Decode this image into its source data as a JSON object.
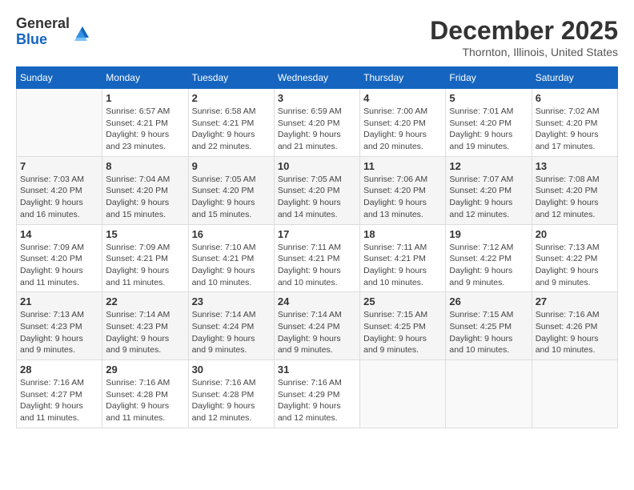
{
  "logo": {
    "general": "General",
    "blue": "Blue"
  },
  "header": {
    "month": "December 2025",
    "location": "Thornton, Illinois, United States"
  },
  "weekdays": [
    "Sunday",
    "Monday",
    "Tuesday",
    "Wednesday",
    "Thursday",
    "Friday",
    "Saturday"
  ],
  "weeks": [
    [
      {
        "day": "",
        "sunrise": "",
        "sunset": "",
        "daylight": ""
      },
      {
        "day": "1",
        "sunrise": "Sunrise: 6:57 AM",
        "sunset": "Sunset: 4:21 PM",
        "daylight": "Daylight: 9 hours and 23 minutes."
      },
      {
        "day": "2",
        "sunrise": "Sunrise: 6:58 AM",
        "sunset": "Sunset: 4:21 PM",
        "daylight": "Daylight: 9 hours and 22 minutes."
      },
      {
        "day": "3",
        "sunrise": "Sunrise: 6:59 AM",
        "sunset": "Sunset: 4:20 PM",
        "daylight": "Daylight: 9 hours and 21 minutes."
      },
      {
        "day": "4",
        "sunrise": "Sunrise: 7:00 AM",
        "sunset": "Sunset: 4:20 PM",
        "daylight": "Daylight: 9 hours and 20 minutes."
      },
      {
        "day": "5",
        "sunrise": "Sunrise: 7:01 AM",
        "sunset": "Sunset: 4:20 PM",
        "daylight": "Daylight: 9 hours and 19 minutes."
      },
      {
        "day": "6",
        "sunrise": "Sunrise: 7:02 AM",
        "sunset": "Sunset: 4:20 PM",
        "daylight": "Daylight: 9 hours and 17 minutes."
      }
    ],
    [
      {
        "day": "7",
        "sunrise": "Sunrise: 7:03 AM",
        "sunset": "Sunset: 4:20 PM",
        "daylight": "Daylight: 9 hours and 16 minutes."
      },
      {
        "day": "8",
        "sunrise": "Sunrise: 7:04 AM",
        "sunset": "Sunset: 4:20 PM",
        "daylight": "Daylight: 9 hours and 15 minutes."
      },
      {
        "day": "9",
        "sunrise": "Sunrise: 7:05 AM",
        "sunset": "Sunset: 4:20 PM",
        "daylight": "Daylight: 9 hours and 15 minutes."
      },
      {
        "day": "10",
        "sunrise": "Sunrise: 7:05 AM",
        "sunset": "Sunset: 4:20 PM",
        "daylight": "Daylight: 9 hours and 14 minutes."
      },
      {
        "day": "11",
        "sunrise": "Sunrise: 7:06 AM",
        "sunset": "Sunset: 4:20 PM",
        "daylight": "Daylight: 9 hours and 13 minutes."
      },
      {
        "day": "12",
        "sunrise": "Sunrise: 7:07 AM",
        "sunset": "Sunset: 4:20 PM",
        "daylight": "Daylight: 9 hours and 12 minutes."
      },
      {
        "day": "13",
        "sunrise": "Sunrise: 7:08 AM",
        "sunset": "Sunset: 4:20 PM",
        "daylight": "Daylight: 9 hours and 12 minutes."
      }
    ],
    [
      {
        "day": "14",
        "sunrise": "Sunrise: 7:09 AM",
        "sunset": "Sunset: 4:20 PM",
        "daylight": "Daylight: 9 hours and 11 minutes."
      },
      {
        "day": "15",
        "sunrise": "Sunrise: 7:09 AM",
        "sunset": "Sunset: 4:21 PM",
        "daylight": "Daylight: 9 hours and 11 minutes."
      },
      {
        "day": "16",
        "sunrise": "Sunrise: 7:10 AM",
        "sunset": "Sunset: 4:21 PM",
        "daylight": "Daylight: 9 hours and 10 minutes."
      },
      {
        "day": "17",
        "sunrise": "Sunrise: 7:11 AM",
        "sunset": "Sunset: 4:21 PM",
        "daylight": "Daylight: 9 hours and 10 minutes."
      },
      {
        "day": "18",
        "sunrise": "Sunrise: 7:11 AM",
        "sunset": "Sunset: 4:21 PM",
        "daylight": "Daylight: 9 hours and 10 minutes."
      },
      {
        "day": "19",
        "sunrise": "Sunrise: 7:12 AM",
        "sunset": "Sunset: 4:22 PM",
        "daylight": "Daylight: 9 hours and 9 minutes."
      },
      {
        "day": "20",
        "sunrise": "Sunrise: 7:13 AM",
        "sunset": "Sunset: 4:22 PM",
        "daylight": "Daylight: 9 hours and 9 minutes."
      }
    ],
    [
      {
        "day": "21",
        "sunrise": "Sunrise: 7:13 AM",
        "sunset": "Sunset: 4:23 PM",
        "daylight": "Daylight: 9 hours and 9 minutes."
      },
      {
        "day": "22",
        "sunrise": "Sunrise: 7:14 AM",
        "sunset": "Sunset: 4:23 PM",
        "daylight": "Daylight: 9 hours and 9 minutes."
      },
      {
        "day": "23",
        "sunrise": "Sunrise: 7:14 AM",
        "sunset": "Sunset: 4:24 PM",
        "daylight": "Daylight: 9 hours and 9 minutes."
      },
      {
        "day": "24",
        "sunrise": "Sunrise: 7:14 AM",
        "sunset": "Sunset: 4:24 PM",
        "daylight": "Daylight: 9 hours and 9 minutes."
      },
      {
        "day": "25",
        "sunrise": "Sunrise: 7:15 AM",
        "sunset": "Sunset: 4:25 PM",
        "daylight": "Daylight: 9 hours and 9 minutes."
      },
      {
        "day": "26",
        "sunrise": "Sunrise: 7:15 AM",
        "sunset": "Sunset: 4:25 PM",
        "daylight": "Daylight: 9 hours and 10 minutes."
      },
      {
        "day": "27",
        "sunrise": "Sunrise: 7:16 AM",
        "sunset": "Sunset: 4:26 PM",
        "daylight": "Daylight: 9 hours and 10 minutes."
      }
    ],
    [
      {
        "day": "28",
        "sunrise": "Sunrise: 7:16 AM",
        "sunset": "Sunset: 4:27 PM",
        "daylight": "Daylight: 9 hours and 11 minutes."
      },
      {
        "day": "29",
        "sunrise": "Sunrise: 7:16 AM",
        "sunset": "Sunset: 4:28 PM",
        "daylight": "Daylight: 9 hours and 11 minutes."
      },
      {
        "day": "30",
        "sunrise": "Sunrise: 7:16 AM",
        "sunset": "Sunset: 4:28 PM",
        "daylight": "Daylight: 9 hours and 12 minutes."
      },
      {
        "day": "31",
        "sunrise": "Sunrise: 7:16 AM",
        "sunset": "Sunset: 4:29 PM",
        "daylight": "Daylight: 9 hours and 12 minutes."
      },
      {
        "day": "",
        "sunrise": "",
        "sunset": "",
        "daylight": ""
      },
      {
        "day": "",
        "sunrise": "",
        "sunset": "",
        "daylight": ""
      },
      {
        "day": "",
        "sunrise": "",
        "sunset": "",
        "daylight": ""
      }
    ]
  ]
}
